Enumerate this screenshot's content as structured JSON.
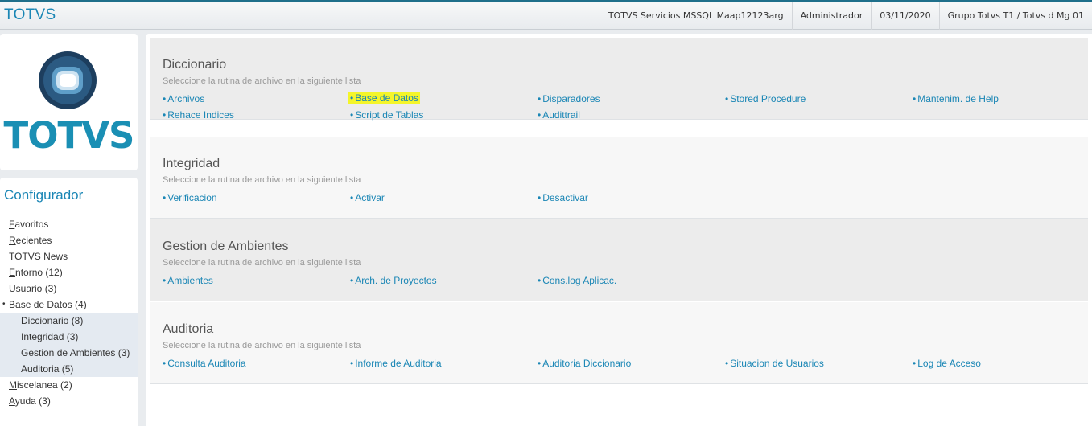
{
  "header": {
    "brand": "TOTVS",
    "server": "TOTVS Servicios MSSQL Maap12123arg",
    "user": "Administrador",
    "date": "03/11/2020",
    "group": "Grupo Totvs T1 / Totvs d Mg 01"
  },
  "logo": {
    "text": "TOTVS",
    "color": "#1a8fb4"
  },
  "sidebar": {
    "title": "Configurador",
    "items": [
      {
        "label": "Favoritos",
        "underline_char": "F",
        "rest": "avoritos"
      },
      {
        "label": "Recientes",
        "underline_char": "R",
        "rest": "ecientes"
      },
      {
        "label": "TOTVS News"
      },
      {
        "label": "Entorno (12)",
        "underline_char": "E",
        "rest": "ntorno (12)"
      },
      {
        "label": "Usuario (3)",
        "underline_char": "U",
        "rest": "suario (3)"
      },
      {
        "label": "Base de Datos (4)",
        "underline_char": "B",
        "rest": "ase de Datos (4)"
      },
      {
        "label": "Diccionario (8)"
      },
      {
        "label": "Integridad (3)"
      },
      {
        "label": "Gestion de Ambientes (3)"
      },
      {
        "label": "Auditoria (5)"
      },
      {
        "label": "Miscelanea (2)",
        "underline_char": "M",
        "rest": "iscelanea (2)"
      },
      {
        "label": "Ayuda (3)",
        "underline_char": "A",
        "rest": "yuda (3)"
      }
    ]
  },
  "sections": [
    {
      "title": "Diccionario",
      "subtitle": "Seleccione la rutina de archivo en la siguiente lista",
      "links": [
        "Archivos",
        "Base de Datos",
        "Disparadores",
        "Stored Procedure",
        "Mantenim. de Help",
        "Rehace Indices",
        "Script de Tablas",
        "Audittrail"
      ]
    },
    {
      "title": "Integridad",
      "subtitle": "Seleccione la rutina de archivo en la siguiente lista",
      "links": [
        "Verificacion",
        "Activar",
        "Desactivar"
      ]
    },
    {
      "title": "Gestion de Ambientes",
      "subtitle": "Seleccione la rutina de archivo en la siguiente lista",
      "links": [
        "Ambientes",
        "Arch. de Proyectos",
        "Cons.log Aplicac."
      ]
    },
    {
      "title": "Auditoria",
      "subtitle": "Seleccione la rutina de archivo en la siguiente lista",
      "links": [
        "Consulta Auditoria",
        "Informe de Auditoria",
        "Auditoria Diccionario",
        "Situacion de Usuarios",
        "Log de Acceso"
      ]
    }
  ],
  "colors": {
    "accent": "#1a86b5",
    "highlight": "#f4f52a"
  },
  "bullet": "•"
}
